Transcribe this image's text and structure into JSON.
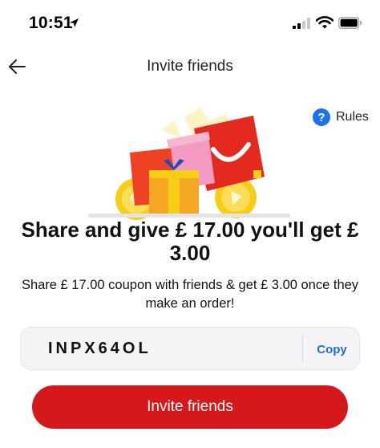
{
  "status_bar": {
    "time": "10:51",
    "icons": [
      "location-arrow-icon",
      "signal-icon",
      "wifi-icon",
      "battery-icon"
    ]
  },
  "nav": {
    "title": "Invite friends",
    "back_icon": "back-arrow-icon"
  },
  "rules": {
    "icon": "question-circle-icon",
    "icon_glyph": "?",
    "label": "Rules"
  },
  "headline": "Share and give  £ 17.00  you'll get £ 3.00",
  "subtitle": "Share  £ 17.00 coupon with friends & get  £ 3.00 once they make an order!",
  "invite_code": {
    "code": "INPX64OL",
    "copy_label": "Copy"
  },
  "invite_button": {
    "label": "Invite friends"
  },
  "colors": {
    "primary_red": "#d4181c",
    "link_blue": "#1a6fd1",
    "rules_blue": "#1a73e8"
  }
}
